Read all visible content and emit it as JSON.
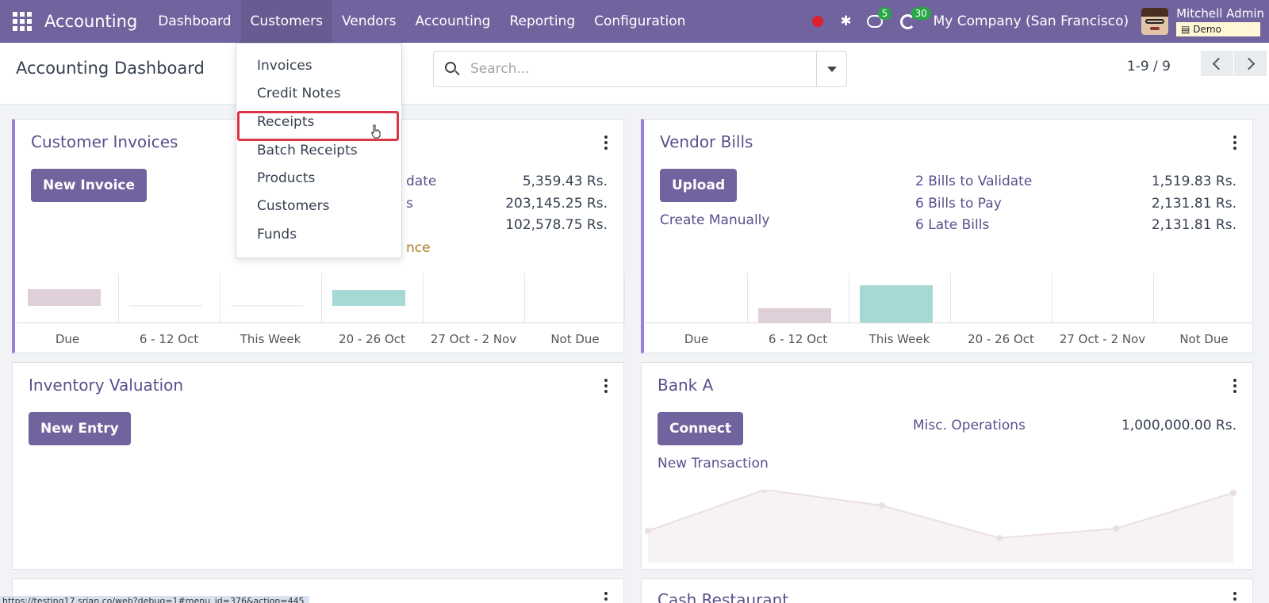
{
  "navbar": {
    "app_name": "Accounting",
    "menu": [
      "Dashboard",
      "Customers",
      "Vendors",
      "Accounting",
      "Reporting",
      "Configuration"
    ],
    "active_menu": "Customers",
    "chat_badge": "5",
    "activity_badge": "30",
    "company": "My Company (San Francisco)",
    "user_name": "Mitchell Admin",
    "db_tag": "Demo"
  },
  "control_panel": {
    "breadcrumb": "Accounting Dashboard",
    "search_placeholder": "Search...",
    "pager": "1-9 / 9"
  },
  "dropdown": {
    "items": [
      "Invoices",
      "Credit Notes",
      "Receipts",
      "Batch Receipts",
      "Products",
      "Customers",
      "Funds"
    ],
    "highlighted": "Receipts"
  },
  "cards": {
    "customer_invoices": {
      "title": "Customer Invoices",
      "button": "New Invoice",
      "stat_label_1": "date",
      "stat_label_2": "s",
      "stat_label_3": "nce",
      "values": [
        "5,359.43 Rs.",
        "203,145.25 Rs.",
        "102,578.75 Rs."
      ],
      "graph_labels": [
        "Due",
        "6 - 12 Oct",
        "This Week",
        "20 - 26 Oct",
        "27 Oct - 2 Nov",
        "Not Due"
      ]
    },
    "vendor_bills": {
      "title": "Vendor Bills",
      "button": "Upload",
      "link": "Create Manually",
      "stat_labels": [
        "2 Bills to Validate",
        "6 Bills to Pay",
        "6 Late Bills"
      ],
      "values": [
        "1,519.83 Rs.",
        "2,131.81 Rs.",
        "2,131.81 Rs."
      ],
      "graph_labels": [
        "Due",
        "6 - 12 Oct",
        "This Week",
        "20 - 26 Oct",
        "27 Oct - 2 Nov",
        "Not Due"
      ]
    },
    "inventory_valuation": {
      "title": "Inventory Valuation",
      "button": "New Entry"
    },
    "bank_a": {
      "title": "Bank A",
      "button": "Connect",
      "link": "New Transaction",
      "stat_label": "Misc. Operations",
      "value": "1,000,000.00 Rs."
    },
    "cash_restaurant": {
      "title": "Cash Restaurant"
    }
  },
  "status_url": "https://testing17.srian.co/web?debug=1#menu_id=376&action=445",
  "colors": {
    "brand": "#71639e",
    "highlight_border": "#dc3545",
    "bar_due": "#decfd8",
    "bar_teal": "#a6d9d5"
  }
}
